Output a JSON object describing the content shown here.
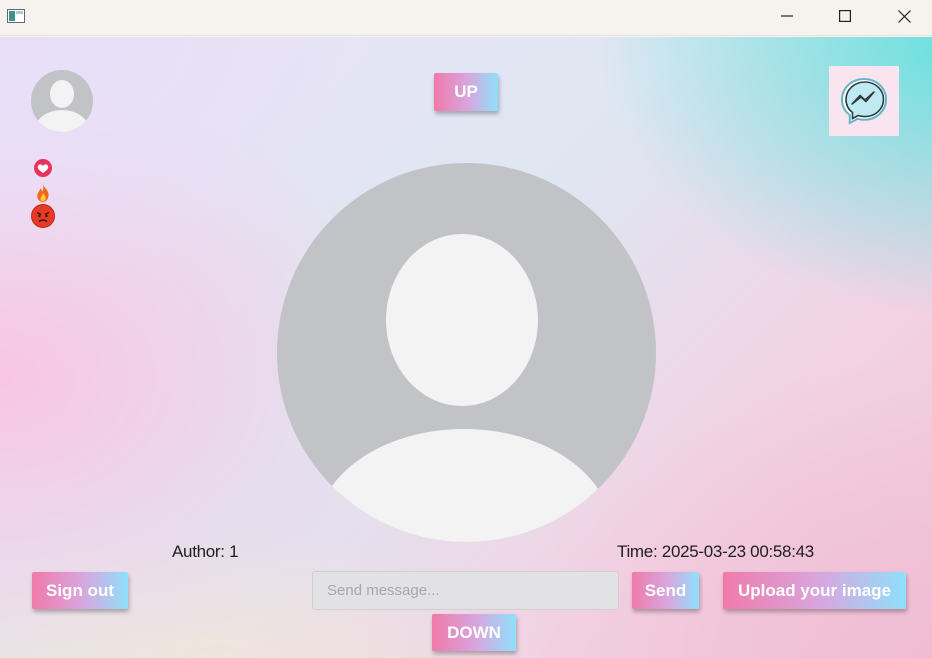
{
  "window": {
    "icon": "app-window-icon",
    "controls": [
      "minimize-icon",
      "maximize-icon",
      "close-icon"
    ]
  },
  "buttons": {
    "up": "UP",
    "down": "DOWN",
    "sign_out": "Sign out",
    "send": "Send",
    "upload": "Upload your image"
  },
  "reactions": [
    "heart-reaction-icon",
    "fire-reaction-icon",
    "angry-reaction-icon"
  ],
  "post": {
    "author": "Author: 1",
    "time": "Time: 2025-03-23 00:58:43"
  },
  "message_input": {
    "value": "",
    "placeholder": "Send message..."
  },
  "colors": {
    "button_gradient": [
      "#f07aaa",
      "#d6a8e0",
      "#8fe0fb"
    ],
    "avatar_bg": "#c2c3c6",
    "avatar_fg": "#f3f3f4",
    "messenger_bg": "#fae4ef"
  }
}
